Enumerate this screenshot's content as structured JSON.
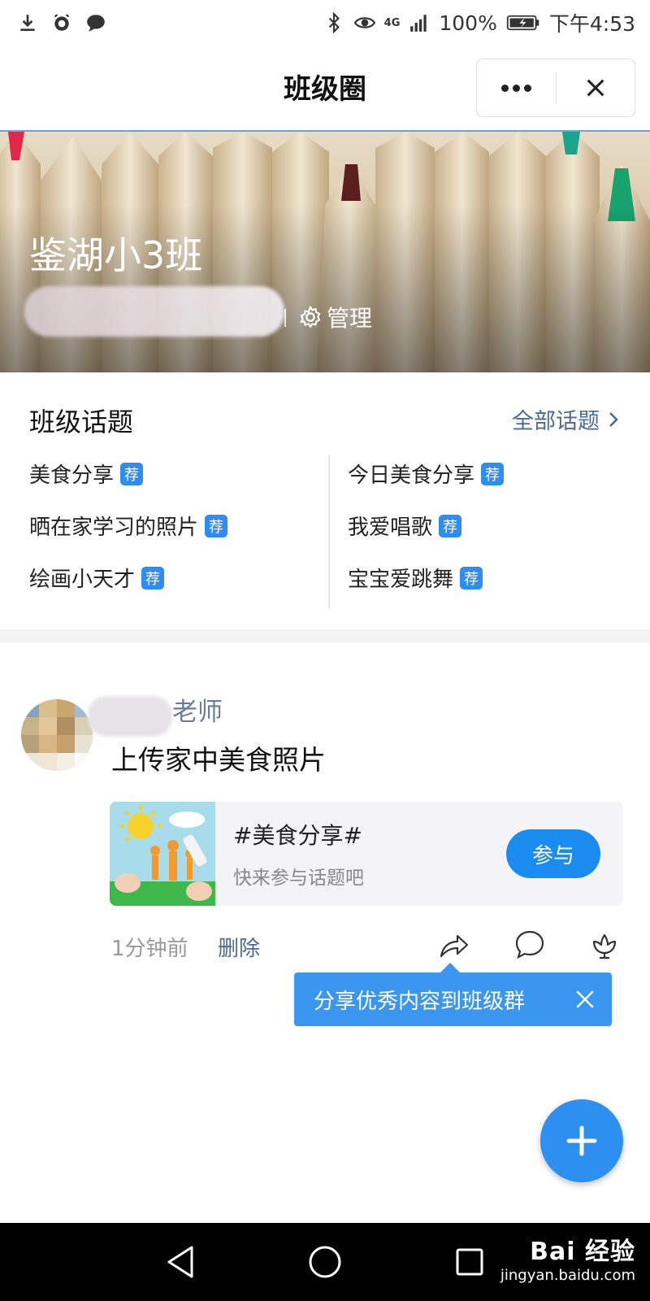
{
  "status_bar": {
    "network": "4G",
    "battery": "100%",
    "time": "下午4:53",
    "icons": [
      "download-icon",
      "alarm-icon",
      "chat-icon",
      "bluetooth-icon",
      "eye-icon",
      "signal-icon",
      "battery-icon"
    ]
  },
  "header": {
    "title": "班级圈",
    "more_icon": "more-dots-icon",
    "close_icon": "close-icon"
  },
  "banner": {
    "class_name": "鉴湖小3班",
    "manage_label": "管理",
    "manage_icon": "gear-icon"
  },
  "topics": {
    "title": "班级话题",
    "all_label": "全部话题",
    "badge": "荐",
    "left": [
      "美食分享",
      "晒在家学习的照片",
      "绘画小天才"
    ],
    "right": [
      "今日美食分享",
      "我爱唱歌",
      "宝宝爱跳舞"
    ]
  },
  "post": {
    "author": "老师",
    "text": "上传家中美食照片",
    "card_title": "#美食分享#",
    "card_subtitle": "快来参与话题吧",
    "join_label": "参与",
    "time": "1分钟前",
    "delete_label": "删除",
    "tooltip": "分享优秀内容到班级群"
  },
  "watermark": {
    "main": "Bai 经验",
    "sub": "jingyan.baidu.com"
  },
  "colors": {
    "accent": "#1a8cf0",
    "link": "#4a6a98",
    "badge": "#2e8df0"
  }
}
